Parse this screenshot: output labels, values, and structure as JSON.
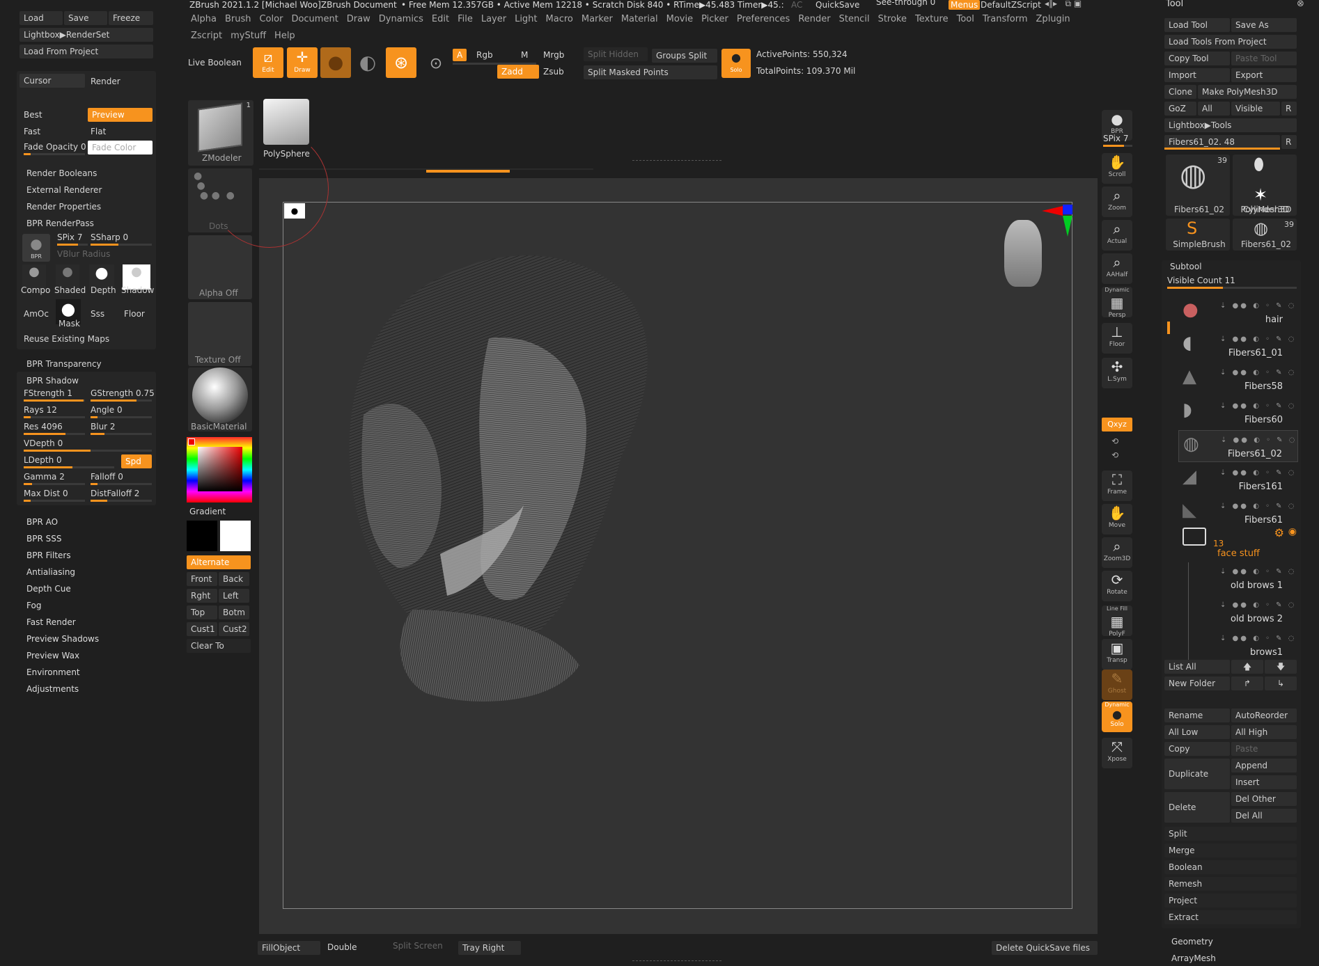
{
  "title_bar": {
    "app": "ZBrush 2021.1.2 [Michael Woo]ZBrush Document",
    "stats": "• Free Mem 12.357GB • Active Mem 12218 • Scratch Disk 840 • RTime▶45.483 Timer▶45.:",
    "ac": "AC",
    "quicksave": "QuickSave",
    "see_through": "See-through  0",
    "menus": "Menus",
    "default_zscript": "DefaultZScript"
  },
  "menu_bar": [
    "Alpha",
    "Brush",
    "Color",
    "Document",
    "Draw",
    "Dynamics",
    "Edit",
    "File",
    "Layer",
    "Light",
    "Macro",
    "Marker",
    "Material",
    "Movie",
    "Picker",
    "Preferences",
    "Render",
    "Stencil",
    "Stroke",
    "Texture",
    "Tool",
    "Transform",
    "Zplugin"
  ],
  "menu_bar2": [
    "Zscript",
    "myStuff",
    "Help"
  ],
  "top_toolbar": {
    "live_boolean": "Live Boolean",
    "edit": "Edit",
    "draw": "Draw",
    "a": "A",
    "rgb": "Rgb",
    "m": "M",
    "mrgb": "Mrgb",
    "zadd": "Zadd",
    "zsub": "Zsub",
    "split_hidden": "Split Hidden",
    "groups_split": "Groups Split",
    "split_masked": "Split Masked Points",
    "dynamic_solo": "Solo",
    "active_points": "ActivePoints: 550,324",
    "total_points": "TotalPoints: 109.370 Mil"
  },
  "left_top": {
    "load": "Load",
    "save": "Save",
    "freeze": "Freeze",
    "lightbox_renderset": "Lightbox▶RenderSet",
    "load_from_project": "Load From Project"
  },
  "render_panel": {
    "cursor": "Cursor",
    "render": "Render",
    "best": "Best",
    "preview": "Preview",
    "fast": "Fast",
    "flat": "Flat",
    "fade_opacity": "Fade Opacity 0",
    "fade_color": "Fade Color",
    "render_booleans": "Render Booleans",
    "external_renderer": "External Renderer",
    "render_properties": "Render Properties",
    "bpr_renderpass": "BPR RenderPass",
    "spix": "SPix 7",
    "ssharp": "SSharp 0",
    "vblur": "VBlur Radius",
    "compo": "Compo",
    "shaded": "Shaded",
    "depth": "Depth",
    "shadow": "Shadow",
    "amoc": "AmOc",
    "mask": "Mask",
    "sss": "Sss",
    "floor": "Floor",
    "reuse_maps": "Reuse Existing Maps",
    "bpr_transparency": "BPR Transparency",
    "bpr_shadow": "BPR Shadow",
    "fstrength": "FStrength 1",
    "gstrength": "GStrength 0.75",
    "rays": "Rays 12",
    "angle": "Angle 0",
    "res": "Res 4096",
    "blur": "Blur 2",
    "vdepth": "VDepth 0",
    "ldepth": "LDepth 0",
    "spd": "Spd",
    "gamma": "Gamma 2",
    "falloff": "Falloff 0",
    "maxdist": "Max Dist 0",
    "distfalloff": "DistFalloff 2",
    "sections": [
      "BPR AO",
      "BPR SSS",
      "BPR Filters",
      "Antialiasing",
      "Depth Cue",
      "Fog",
      "Fast Render",
      "Preview Shadows",
      "Preview Wax",
      "Environment",
      "Adjustments"
    ]
  },
  "shelf": {
    "zmodeler": "ZModeler",
    "zmodeler_count": "1",
    "polysphere": "PolySphere",
    "dots": "Dots",
    "alpha_off": "Alpha Off",
    "texture_off": "Texture Off",
    "basic_material": "BasicMaterial",
    "gradient": "Gradient",
    "alternate": "Alternate",
    "front": "Front",
    "back": "Back",
    "rght": "Rght",
    "left": "Left",
    "top": "Top",
    "botm": "Botm",
    "cust1": "Cust1",
    "cust2": "Cust2",
    "clear_to": "Clear To"
  },
  "right_icons": {
    "bpr": "BPR",
    "spix": "SPix 7",
    "scroll": "Scroll",
    "zoom": "Zoom",
    "actual": "Actual",
    "aahalf": "AAHalf",
    "persp_top": "Dynamic",
    "persp": "Persp",
    "floor": "Floor",
    "lsym": "L.Sym",
    "xyz": "Qxyz",
    "frame": "Frame",
    "move": "Move",
    "zoom3d": "Zoom3D",
    "rotate": "Rotate",
    "polyf_top": "Line Fill",
    "polyf": "PolyF",
    "transp": "Transp",
    "ghost": "Ghost",
    "solo_top": "Dynamic",
    "solo": "Solo",
    "xpose": "Xpose"
  },
  "bottom_bar": {
    "fill_object": "FillObject",
    "double": "Double",
    "split_screen": "Split Screen",
    "tray_right": "Tray Right",
    "delete_quicksave": "Delete QuickSave files"
  },
  "tool_panel": {
    "title": "Tool",
    "load_tool": "Load Tool",
    "save_as": "Save As",
    "load_tools_project": "Load Tools From Project",
    "copy_tool": "Copy Tool",
    "paste_tool": "Paste Tool",
    "import": "Import",
    "export": "Export",
    "clone": "Clone",
    "make_polymesh": "Make PolyMesh3D",
    "goz": "GoZ",
    "all": "All",
    "visible": "Visible",
    "r": "R",
    "lightbox_tools": "Lightbox▶Tools",
    "current_tool": "Fibers61_02. 48",
    "r2": "R",
    "tools": [
      {
        "name": "Fibers61_02",
        "count": "39"
      },
      {
        "name": "Cylinder3D",
        "count": ""
      },
      {
        "name": "PolyMesh3D",
        "count": ""
      },
      {
        "name": "SimpleBrush",
        "count": ""
      },
      {
        "name": "Fibers61_02",
        "count": "39"
      }
    ],
    "subtool": "Subtool",
    "visible_count": "Visible Count 11",
    "subtools": [
      "hair",
      "Fibers61_01",
      "Fibers58",
      "Fibers60",
      "Fibers61_02",
      "Fibers161",
      "Fibers61"
    ],
    "folder_count": "13",
    "folder_name": "face stuff",
    "folder_subtools": [
      "old brows 1",
      "old brows 2",
      "brows1"
    ],
    "list_all": "List All",
    "new_folder": "New Folder",
    "rename": "Rename",
    "autoreorder": "AutoReorder",
    "all_low": "All Low",
    "all_high": "All High",
    "copy": "Copy",
    "paste": "Paste",
    "duplicate": "Duplicate",
    "append": "Append",
    "insert": "Insert",
    "delete": "Delete",
    "del_other": "Del Other",
    "del_all": "Del All",
    "actions": [
      "Split",
      "Merge",
      "Boolean",
      "Remesh",
      "Project",
      "Extract"
    ],
    "geometry": "Geometry",
    "arraymesh": "ArrayMesh"
  },
  "colors": {
    "accent": "#f7931e",
    "background": "#1f1f1f",
    "canvas": "#333333"
  }
}
